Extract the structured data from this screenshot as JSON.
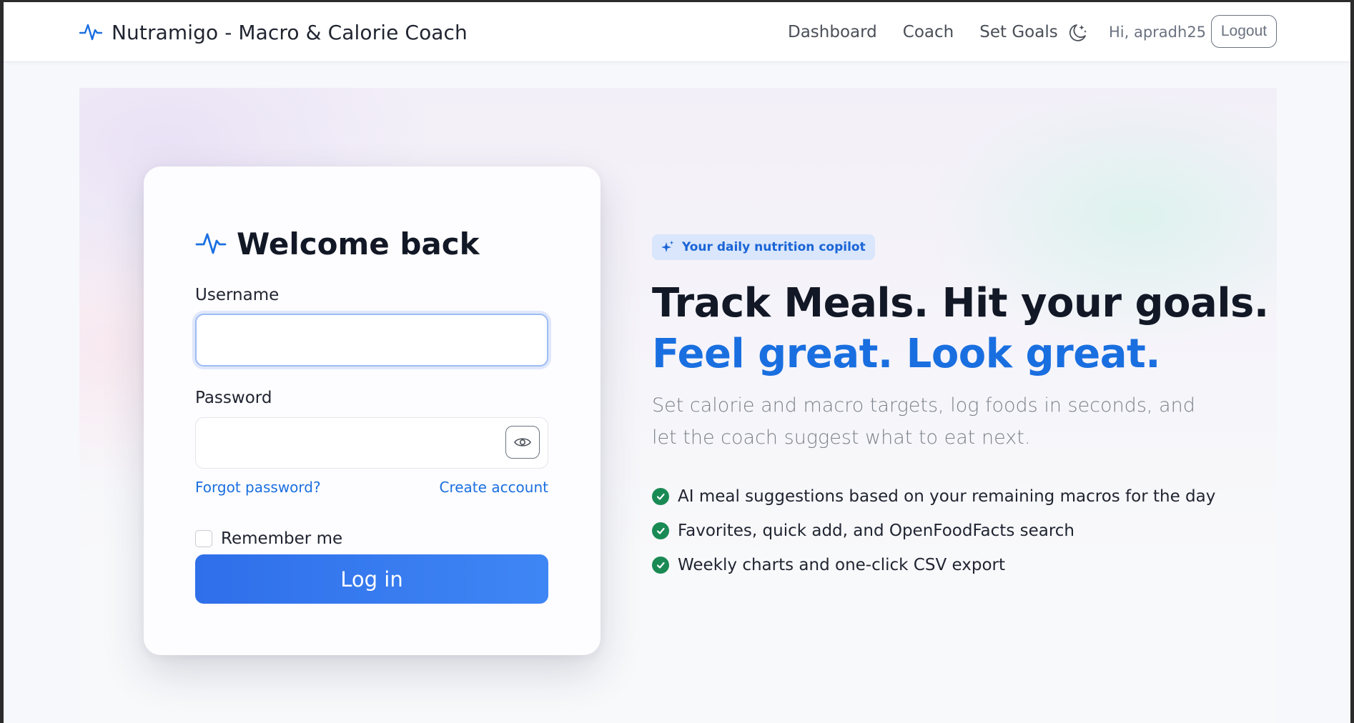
{
  "navbar": {
    "brand": "Nutramigo - Macro & Calorie Coach",
    "links": [
      "Dashboard",
      "Coach",
      "Set Goals"
    ],
    "theme_toggle_icon": "moon-stars-icon",
    "greeting": "Hi, apradh25",
    "logout_label": "Logout"
  },
  "login": {
    "title": "Welcome back",
    "username_label": "Username",
    "username_value": "",
    "password_label": "Password",
    "password_value": "",
    "forgot_label": "Forgot password?",
    "create_label": "Create account",
    "remember_label": "Remember me",
    "remember_checked": false,
    "submit_label": "Log in"
  },
  "hero": {
    "badge": "Your daily nutrition copilot",
    "headline_line1": "Track Meals. Hit your goals.",
    "headline_line2": "Feel great. Look great.",
    "subtitle": "Set calorie and macro targets, log foods in seconds, and let the coach suggest what to eat next.",
    "features": [
      "AI meal suggestions based on your remaining macros for the day",
      "Favorites, quick add, and OpenFoodFacts search",
      "Weekly charts and one-click CSV export"
    ]
  },
  "colors": {
    "accent": "#1a6fe0",
    "button_start": "#2f6fea",
    "button_end": "#3f86f5",
    "success": "#1a8a55",
    "badge_bg": "#d9e6fb"
  }
}
